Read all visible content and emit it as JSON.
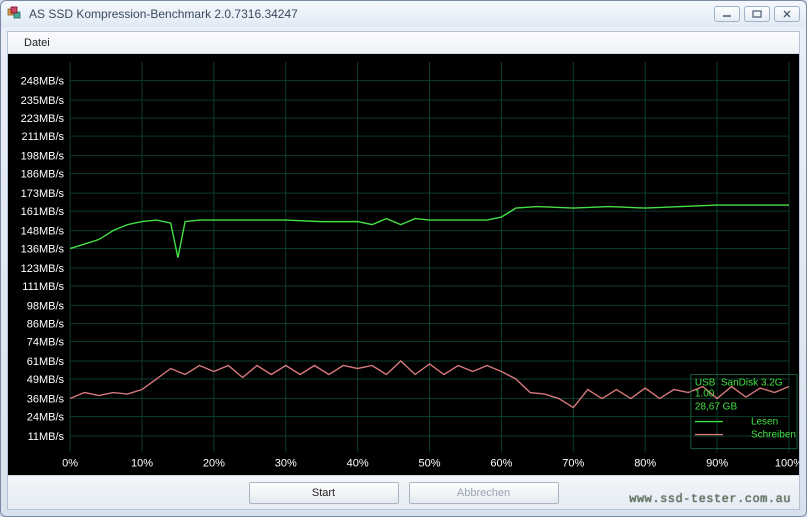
{
  "window": {
    "title": "AS SSD Kompression-Benchmark 2.0.7316.34247"
  },
  "menu": {
    "file": "Datei"
  },
  "buttons": {
    "start": "Start",
    "abort": "Abbrechen"
  },
  "watermark": "www.ssd-tester.com.au",
  "info_box": {
    "line1": "USB",
    "line2": "SanDisk 3.2G",
    "line3": "1.00",
    "line4": "28,67 GB"
  },
  "legend": {
    "read": "Lesen",
    "write": "Schreiben"
  },
  "chart_data": {
    "type": "line",
    "xlabel": "",
    "ylabel": "",
    "x_unit": "%",
    "y_unit": "MB/s",
    "xlim": [
      0,
      100
    ],
    "ylim": [
      0,
      260.4
    ],
    "y_ticks": [
      11,
      24,
      36,
      49,
      61,
      74,
      86,
      98,
      111,
      123,
      136,
      148,
      161,
      173,
      186,
      198,
      211,
      223,
      235,
      248
    ],
    "y_tick_labels": [
      "11MB/s",
      "24MB/s",
      "36MB/s",
      "49MB/s",
      "61MB/s",
      "74MB/s",
      "86MB/s",
      "98MB/s",
      "111MB/s",
      "123MB/s",
      "136MB/s",
      "148MB/s",
      "161MB/s",
      "173MB/s",
      "186MB/s",
      "198MB/s",
      "211MB/s",
      "223MB/s",
      "235MB/s",
      "248MB/s"
    ],
    "x_ticks": [
      0,
      10,
      20,
      30,
      40,
      50,
      60,
      70,
      80,
      90,
      100
    ],
    "x_tick_labels": [
      "0%",
      "10%",
      "20%",
      "30%",
      "40%",
      "50%",
      "60%",
      "70%",
      "80%",
      "90%",
      "100%"
    ],
    "series": [
      {
        "name": "Lesen",
        "color": "#44e044",
        "x": [
          0,
          2,
          4,
          6,
          8,
          10,
          12,
          14,
          15,
          16,
          18,
          20,
          25,
          30,
          35,
          40,
          42,
          44,
          46,
          48,
          50,
          55,
          58,
          60,
          62,
          65,
          70,
          75,
          80,
          85,
          90,
          95,
          100
        ],
        "y": [
          136,
          139,
          142,
          148,
          152,
          154,
          155,
          153,
          130,
          154,
          155,
          155,
          155,
          155,
          154,
          154,
          152,
          156,
          152,
          156,
          155,
          155,
          155,
          157,
          163,
          164,
          163,
          164,
          163,
          164,
          165,
          165,
          165
        ]
      },
      {
        "name": "Schreiben",
        "color": "#d4787a",
        "x": [
          0,
          2,
          4,
          6,
          8,
          10,
          12,
          14,
          16,
          18,
          20,
          22,
          24,
          26,
          28,
          30,
          32,
          34,
          36,
          38,
          40,
          42,
          44,
          46,
          48,
          50,
          52,
          54,
          56,
          58,
          60,
          62,
          64,
          66,
          68,
          70,
          72,
          74,
          76,
          78,
          80,
          82,
          84,
          86,
          88,
          90,
          92,
          94,
          96,
          98,
          100
        ],
        "y": [
          36,
          40,
          38,
          40,
          39,
          42,
          49,
          56,
          52,
          58,
          54,
          58,
          50,
          58,
          52,
          58,
          52,
          58,
          52,
          58,
          56,
          58,
          52,
          61,
          52,
          59,
          52,
          58,
          54,
          58,
          54,
          49,
          40,
          39,
          36,
          30,
          42,
          36,
          42,
          36,
          43,
          36,
          42,
          40,
          44,
          36,
          44,
          37,
          43,
          40,
          44
        ]
      }
    ]
  }
}
